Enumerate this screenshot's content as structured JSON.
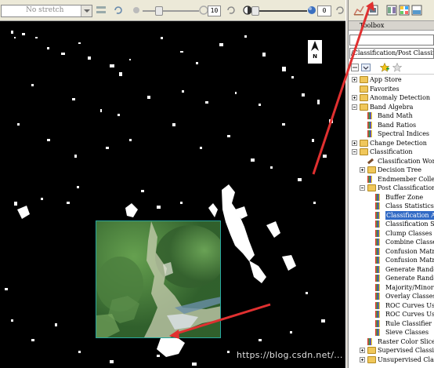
{
  "toolbar": {
    "stretch_value": "No stretch",
    "brightness_value": "10",
    "transparency_value": "0"
  },
  "image_view": {
    "north_label": "N"
  },
  "toolbox": {
    "title": "Toolbox",
    "path": "/Classification/Post Classification",
    "tree": [
      {
        "label": "App Store",
        "level": 0,
        "type": "folder",
        "expander": "plus"
      },
      {
        "label": "Favorites",
        "level": 0,
        "type": "folder",
        "expander": "none"
      },
      {
        "label": "Anomaly Detection",
        "level": 0,
        "type": "folder",
        "expander": "plus"
      },
      {
        "label": "Band Algebra",
        "level": 0,
        "type": "folder",
        "expander": "minus"
      },
      {
        "label": "Band Math",
        "level": 1,
        "type": "tool"
      },
      {
        "label": "Band Ratios",
        "level": 1,
        "type": "tool"
      },
      {
        "label": "Spectral Indices",
        "level": 1,
        "type": "tool"
      },
      {
        "label": "Change Detection",
        "level": 0,
        "type": "folder",
        "expander": "plus"
      },
      {
        "label": "Classification",
        "level": 0,
        "type": "folder",
        "expander": "minus"
      },
      {
        "label": "Classification Workflow",
        "level": 1,
        "type": "pencil"
      },
      {
        "label": "Decision Tree",
        "level": 1,
        "type": "folder",
        "expander": "plus"
      },
      {
        "label": "Endmember Collection",
        "level": 1,
        "type": "tool"
      },
      {
        "label": "Post Classification",
        "level": 1,
        "type": "folder",
        "expander": "minus"
      },
      {
        "label": "Buffer Zone",
        "level": 2,
        "type": "tool"
      },
      {
        "label": "Class Statistics",
        "level": 2,
        "type": "tool"
      },
      {
        "label": "Classification Aggregation",
        "level": 2,
        "type": "tool",
        "selected": true
      },
      {
        "label": "Classification Smoothing",
        "level": 2,
        "type": "tool"
      },
      {
        "label": "Clump Classes",
        "level": 2,
        "type": "tool"
      },
      {
        "label": "Combine Classes",
        "level": 2,
        "type": "tool"
      },
      {
        "label": "Confusion Matrix",
        "level": 2,
        "type": "tool"
      },
      {
        "label": "Confusion Matrix",
        "level": 2,
        "type": "tool"
      },
      {
        "label": "Generate Random Sample",
        "level": 2,
        "type": "tool"
      },
      {
        "label": "Generate Random Sample",
        "level": 2,
        "type": "tool"
      },
      {
        "label": "Majority/Minority",
        "level": 2,
        "type": "tool"
      },
      {
        "label": "Overlay Classes",
        "level": 2,
        "type": "tool"
      },
      {
        "label": "ROC Curves Using",
        "level": 2,
        "type": "tool"
      },
      {
        "label": "ROC Curves Using",
        "level": 2,
        "type": "tool"
      },
      {
        "label": "Rule Classifier",
        "level": 2,
        "type": "tool"
      },
      {
        "label": "Sieve Classes",
        "level": 2,
        "type": "tool"
      },
      {
        "label": "Raster Color Slices",
        "level": 1,
        "type": "tool"
      },
      {
        "label": "Supervised Classification",
        "level": 1,
        "type": "folder",
        "expander": "plus"
      },
      {
        "label": "Unsupervised Classification",
        "level": 1,
        "type": "folder",
        "expander": "plus"
      }
    ]
  },
  "watermark": "https://blog.csdn.net/...",
  "colors": {
    "arrow": "#e03030",
    "selection": "#316ac5",
    "inset_border": "#27a79e"
  }
}
